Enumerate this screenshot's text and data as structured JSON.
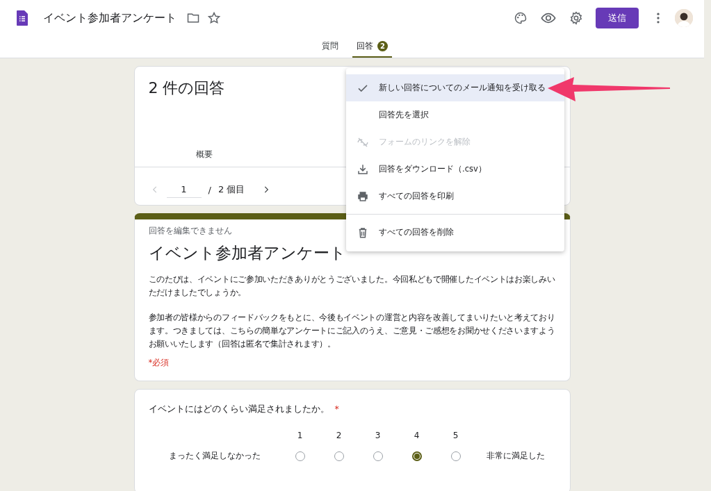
{
  "app": {
    "title": "イベント参加者アンケート",
    "send_button": "送信"
  },
  "tabs": [
    {
      "label": "質問",
      "selected": false
    },
    {
      "label": "回答",
      "selected": true,
      "badge": "2"
    }
  ],
  "summary": {
    "title": "2 件の回答",
    "tabs": [
      {
        "label": "概要",
        "selected": false
      }
    ],
    "pager": {
      "current": "1",
      "separator": "/",
      "total": "2 個目"
    }
  },
  "menu": [
    {
      "kind": "check",
      "label": "新しい回答についてのメール通知を受け取る",
      "selected": true,
      "disabled": false
    },
    {
      "kind": "plain",
      "label": "回答先を選択",
      "selected": false,
      "disabled": false
    },
    {
      "kind": "unlink",
      "label": "フォームのリンクを解除",
      "selected": false,
      "disabled": true
    },
    {
      "kind": "download",
      "label": "回答をダウンロード（.csv）",
      "selected": false,
      "disabled": false
    },
    {
      "kind": "print",
      "label": "すべての回答を印刷",
      "selected": false,
      "disabled": false
    },
    {
      "kind": "delete",
      "label": "すべての回答を削除",
      "selected": false,
      "disabled": false
    }
  ],
  "form": {
    "notice": "回答を編集できません",
    "title": "イベント参加者アンケート",
    "paragraphs": [
      "このたびは、イベントにご参加いただきありがとうございました。今回私どもで開催したイベントはお楽しみいただけましたでしょうか。",
      "参加者の皆様からのフィードバックをもとに、今後もイベントの運営と内容を改善してまいりたいと考えております。つきましては、こちらの簡単なアンケートにご記入のうえ、ご意見・ご感想をお聞かせくださいますようお願いいたします（回答は匿名で集計されます）。"
    ],
    "required_note": "*必須"
  },
  "question": {
    "text": "イベントにはどのくらい満足されましたか。",
    "required_mark": "*",
    "low_label": "まったく満足しなかった",
    "high_label": "非常に満足した",
    "scale": [
      {
        "label": "1",
        "selected": false
      },
      {
        "label": "2",
        "selected": false
      },
      {
        "label": "3",
        "selected": false
      },
      {
        "label": "4",
        "selected": true
      },
      {
        "label": "5",
        "selected": false
      }
    ]
  }
}
